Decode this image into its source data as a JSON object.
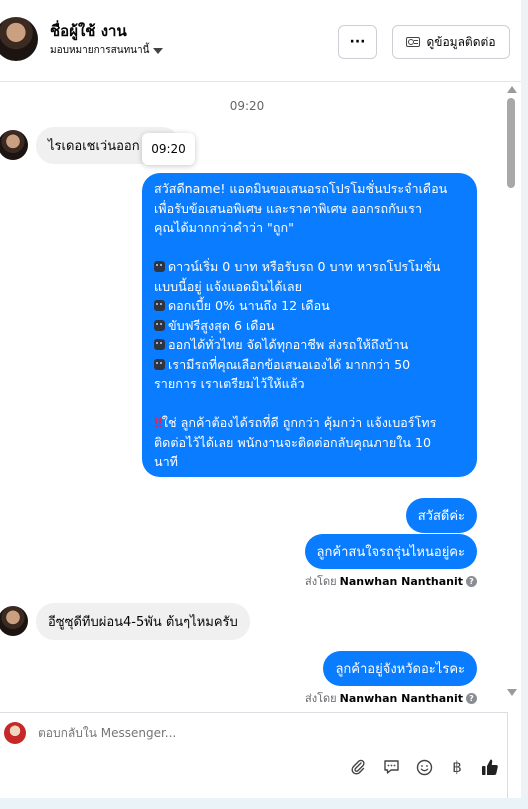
{
  "header": {
    "contact_name": "ชื่อผู้ใช้ งาน",
    "assignment_label": "มอบหมายการสนทนานี้",
    "more_label": "···",
    "contact_info_label": "ดูข้อมูลติดต่อ"
  },
  "chat": {
    "time_separator": "09:20",
    "tooltip_time": "09:20",
    "incoming_1": "ไรเดอเชเว่นออก ครับ",
    "long_message": {
      "lines": [
        "สวัสดีname! แอดมินขอเสนอรถโปรโมชั่นประจำเดือน",
        "เพื่อรับข้อเสนอพิเศษ และราคาพิเศษ ออกรถกับเรา",
        "คุณได้มากกว่าคำว่า \"ถูก\"",
        "",
        "ดาวน์เริ่ม 0 บาท หรือรับรถ 0 บาท หารถโปรโมชั่น",
        "แบบนี้อยู่ แจ้งแอดมินได้เลย",
        "ดอกเบี้ย 0% นานถึง 12 เดือน",
        "ขับฟรีสูงสุด 6 เดือน",
        "ออกได้ทั่วไทย จัดได้ทุกอาชีพ ส่งรถให้ถึงบ้าน",
        "เรามีรถที่คุณเลือกข้อเสนอเองได้ มากกว่า 50",
        "รายการ เราเตรียมไว้ให้แล้ว",
        "",
        "ใช่ ลูกค้าต้องได้รถที่ดี ถูกกว่า คุ้มกว่า แจ้งเบอร์โทร",
        "ติดต่อไว้ได้เลย พนักงานจะติดต่อกลับคุณภายใน 10",
        "นาที"
      ]
    },
    "outgoing_1": "สวัสดีค่ะ",
    "outgoing_2": "ลูกค้าสนใจรถรุ่นไหนอยู่คะ",
    "sent_by_prefix": "ส่งโดย",
    "sent_by_name": "Nanwhan Nanthanit",
    "incoming_2": "อีซูซุดีทีบผ่อน4-5พัน ต้นๆไหมครับ",
    "outgoing_3": "ลูกค้าอยู่จังหวัดอะไรคะ",
    "sent_by_prefix_2": "ส่งโดย",
    "sent_by_name_2": "Nanwhan Nanthanit"
  },
  "composer": {
    "placeholder": "ตอบกลับใน Messenger..."
  },
  "colors": {
    "accent": "#0a7cff",
    "incoming_bubble": "#f0f0f0"
  }
}
